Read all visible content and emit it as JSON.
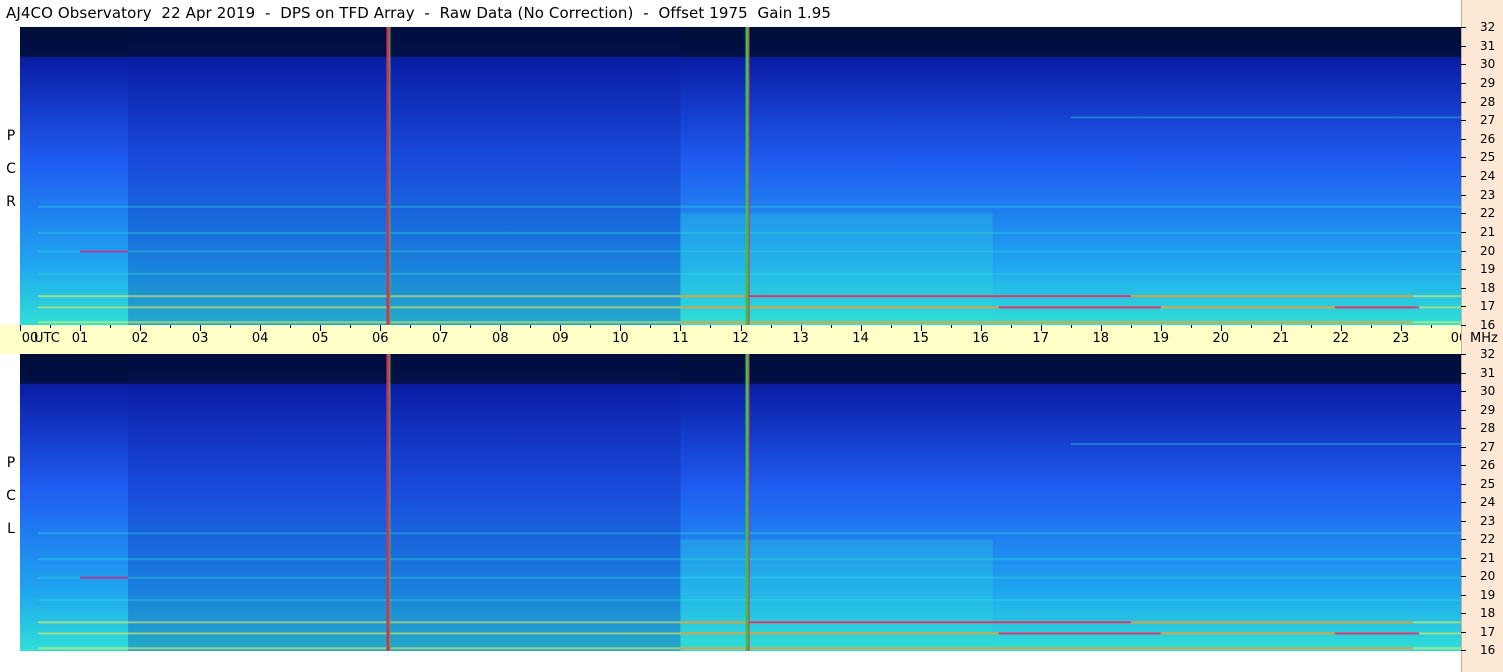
{
  "title": "AJ4CO Observatory  22 Apr 2019  -  DPS on TFD Array  -  Raw Data (No Correction)  -  Offset 1975  Gain 1.95",
  "chart_data": {
    "type": "heatmap",
    "title": "AJ4CO Observatory  22 Apr 2019  -  DPS on TFD Array  -  Raw Data (No Correction)  -  Offset 1975  Gain 1.95",
    "x_axis": {
      "label": "UTC",
      "range": [
        0,
        24
      ],
      "tick_labels": [
        "00",
        "01",
        "02",
        "03",
        "04",
        "05",
        "06",
        "07",
        "08",
        "09",
        "10",
        "11",
        "12",
        "13",
        "14",
        "15",
        "16",
        "17",
        "18",
        "19",
        "20",
        "21",
        "22",
        "23",
        "00"
      ]
    },
    "y_axis": {
      "label": "MHz",
      "range": [
        16,
        32
      ],
      "tick_labels": [
        "16",
        "17",
        "18",
        "19",
        "20",
        "21",
        "22",
        "23",
        "24",
        "25",
        "26",
        "27",
        "28",
        "29",
        "30",
        "31",
        "32"
      ]
    },
    "panels": [
      {
        "name": "RCP",
        "letters": [
          "R",
          "C",
          "P"
        ]
      },
      {
        "name": "LCP",
        "letters": [
          "L",
          "C",
          "P"
        ]
      }
    ],
    "colormap": [
      "#000e3a",
      "#0b1fa8",
      "#1f5cf0",
      "#1fa6f0",
      "#2fe0d6",
      "#f5f14a",
      "#ff7a1a",
      "#d21f86"
    ],
    "markers_utc": [
      6.12,
      12.1
    ],
    "marker_colors": [
      "#d0325a",
      "#3fbf4f"
    ],
    "features": {
      "rfi_bands_mhz": [
        16.2,
        17.0,
        17.6,
        18.8,
        20.0,
        21.0,
        22.4,
        27.2
      ],
      "bright_region_utc": [
        11.0,
        24.0
      ],
      "dark_top_mhz": [
        30.4,
        32.0
      ]
    }
  }
}
